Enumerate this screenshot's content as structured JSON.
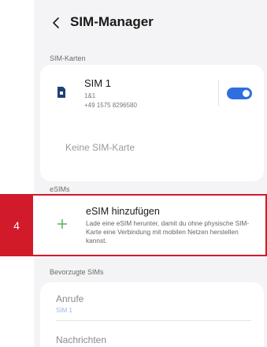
{
  "header": {
    "title": "SIM-Manager"
  },
  "sections": {
    "sim_cards": "SIM-Karten",
    "esims": "eSIMs",
    "preferred": "Bevorzugte SIMs"
  },
  "sim1": {
    "name": "SIM 1",
    "carrier": "1&1",
    "number": "+49 1575 8296580",
    "enabled": true
  },
  "empty_slot": "Keine SIM-Karte",
  "esim": {
    "title": "eSIM hinzufügen",
    "description": "Lade eine eSIM herunter, damit du ohne physische SIM-Karte eine Verbindung mit mobilen Netzen herstellen kannst."
  },
  "step_badge": "4",
  "preferred": {
    "calls_label": "Anrufe",
    "calls_value": "SIM 1",
    "messages_label": "Nachrichten"
  },
  "colors": {
    "accent": "#2e6fe0",
    "highlight": "#d11a2a"
  }
}
